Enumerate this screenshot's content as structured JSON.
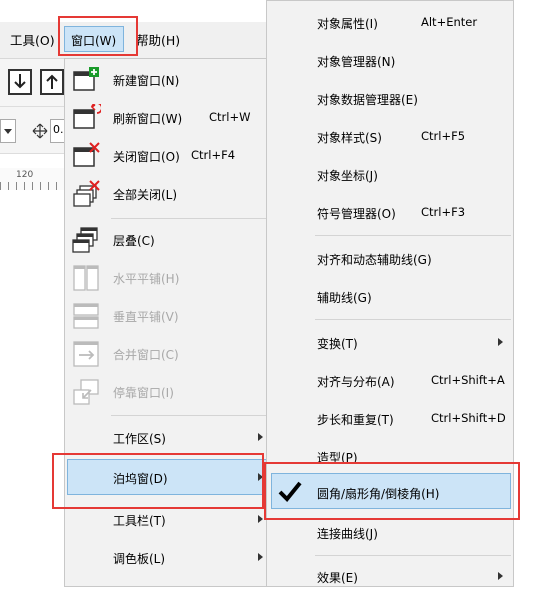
{
  "menubar": {
    "tools": "工具(O)",
    "window": "窗口(W)",
    "help": "帮助(H)"
  },
  "toolbar": {
    "zoom_value": "0."
  },
  "ruler": {
    "tick": "120"
  },
  "window_menu": {
    "items": [
      {
        "label": "新建窗口(N)",
        "shortcut": "",
        "icon": "new-window-icon"
      },
      {
        "label": "刷新窗口(W)",
        "shortcut": "Ctrl+W",
        "icon": "refresh-window-icon"
      },
      {
        "label": "关闭窗口(O)",
        "shortcut": "Ctrl+F4",
        "icon": "close-window-icon"
      },
      {
        "label": "全部关闭(L)",
        "shortcut": "",
        "icon": "close-all-icon"
      },
      {
        "label": "层叠(C)",
        "shortcut": "",
        "icon": "cascade-icon"
      },
      {
        "label": "水平平铺(H)",
        "shortcut": "",
        "icon": "tile-horizontal-icon"
      },
      {
        "label": "垂直平铺(V)",
        "shortcut": "",
        "icon": "tile-vertical-icon"
      },
      {
        "label": "合并窗口(C)",
        "shortcut": "",
        "icon": "combine-windows-icon"
      },
      {
        "label": "停靠窗口(I)",
        "shortcut": "",
        "icon": "dock-window-icon"
      },
      {
        "label": "工作区(S)",
        "shortcut": "",
        "icon": ""
      },
      {
        "label": "泊坞窗(D)",
        "shortcut": "",
        "icon": ""
      },
      {
        "label": "工具栏(T)",
        "shortcut": "",
        "icon": ""
      },
      {
        "label": "调色板(L)",
        "shortcut": "",
        "icon": ""
      }
    ]
  },
  "docker_menu": {
    "items": [
      {
        "label": "对象属性(I)",
        "shortcut": "Alt+Enter"
      },
      {
        "label": "对象管理器(N)",
        "shortcut": ""
      },
      {
        "label": "对象数据管理器(E)",
        "shortcut": ""
      },
      {
        "label": "对象样式(S)",
        "shortcut": "Ctrl+F5"
      },
      {
        "label": "对象坐标(J)",
        "shortcut": ""
      },
      {
        "label": "符号管理器(O)",
        "shortcut": "Ctrl+F3"
      },
      {
        "label": "对齐和动态辅助线(G)",
        "shortcut": ""
      },
      {
        "label": "辅助线(G)",
        "shortcut": ""
      },
      {
        "label": "变换(T)",
        "shortcut": ""
      },
      {
        "label": "对齐与分布(A)",
        "shortcut": "Ctrl+Shift+A"
      },
      {
        "label": "步长和重复(T)",
        "shortcut": "Ctrl+Shift+D"
      },
      {
        "label": "造型(P)",
        "shortcut": ""
      },
      {
        "label": "圆角/扇形角/倒棱角(H)",
        "shortcut": ""
      },
      {
        "label": "连接曲线(J)",
        "shortcut": ""
      },
      {
        "label": "效果(E)",
        "shortcut": ""
      }
    ]
  },
  "colors": {
    "highlight": "#cce4f7",
    "highlight_border": "#7fb4dd",
    "annotation_red": "#e53935",
    "icon_green": "#1a9b2a",
    "icon_red": "#e02020"
  }
}
